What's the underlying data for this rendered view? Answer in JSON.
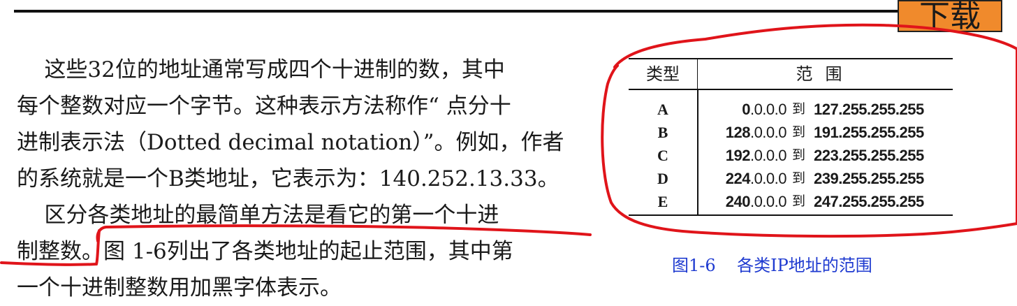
{
  "header": {
    "download_label": "下载"
  },
  "paragraphs": [
    {
      "lines": [
        "    这些32位的地址通常写成四个十进制的数，其中",
        "每个整数对应一个字节。这种表示方法称作“ 点分十",
        "进制表示法（Dotted decimal notation）”。例如，作者",
        "的系统就是一个B类地址，它表示为：140.252.13.33。"
      ]
    },
    {
      "lines": [
        "    区分各类地址的最简单方法是看它的第一个十进",
        "制整数。图 1-6列出了各类地址的起止范围，其中第",
        "一个十进制整数用加黑字体表示。"
      ]
    }
  ],
  "table": {
    "headers": [
      "类型",
      "范围"
    ],
    "rows": [
      {
        "class": "A",
        "from_bold": "0",
        "from_rest": ".0.0.0",
        "to": "到",
        "end_bold": "127",
        "end_rest": ".255.255.255"
      },
      {
        "class": "B",
        "from_bold": "128",
        "from_rest": ".0.0.0",
        "to": "到",
        "end_bold": "191",
        "end_rest": ".255.255.255"
      },
      {
        "class": "C",
        "from_bold": "192",
        "from_rest": ".0.0.0",
        "to": "到",
        "end_bold": "223",
        "end_rest": ".255.255.255"
      },
      {
        "class": "D",
        "from_bold": "224",
        "from_rest": ".0.0.0",
        "to": "到",
        "end_bold": "239",
        "end_rest": ".255.255.255"
      },
      {
        "class": "E",
        "from_bold": "240",
        "from_rest": ".0.0.0",
        "to": "到",
        "end_bold": "247",
        "end_rest": ".255.255.255"
      }
    ]
  },
  "caption": "图1-6    各类IP地址的范围",
  "colors": {
    "annotation": "#e0141a",
    "caption": "#1e3ad0",
    "download_bg": "#f08a2c"
  }
}
